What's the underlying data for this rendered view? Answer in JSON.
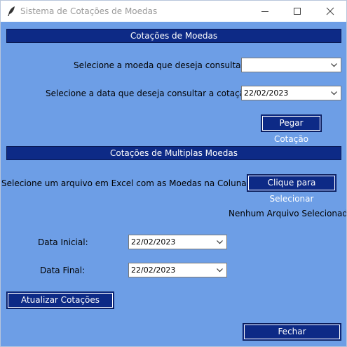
{
  "window": {
    "title": "Sistema de Cotações de Moedas",
    "icon": "feather-icon",
    "controls": [
      "minimize-icon",
      "maximize-icon",
      "close-icon"
    ]
  },
  "section1": {
    "header": "Cotações de Moedas",
    "currency_label": "Selecione a moeda que deseja consultar:",
    "currency_value": "",
    "date_label": "Selecione a data que deseja consultar a cotação:",
    "date_value": "22/02/2023",
    "get_button": "Pegar Cotação"
  },
  "section2": {
    "header": "Cotações de Multiplas Moedas",
    "file_label": "Selecione um arquivo em Excel com as Moedas na Coluna A:",
    "select_button": "Clique para Selecionar",
    "file_status": "Nenhum Arquivo Selecionado",
    "start_label": "Data Inicial:",
    "start_value": "22/02/2023",
    "end_label": "Data Final:",
    "end_value": "22/02/2023",
    "update_button": "Atualizar Cotações"
  },
  "close_button": "Fechar",
  "colors": {
    "background": "#6d9ee6",
    "accent": "#0d2a86",
    "button_text": "#ffffff"
  }
}
